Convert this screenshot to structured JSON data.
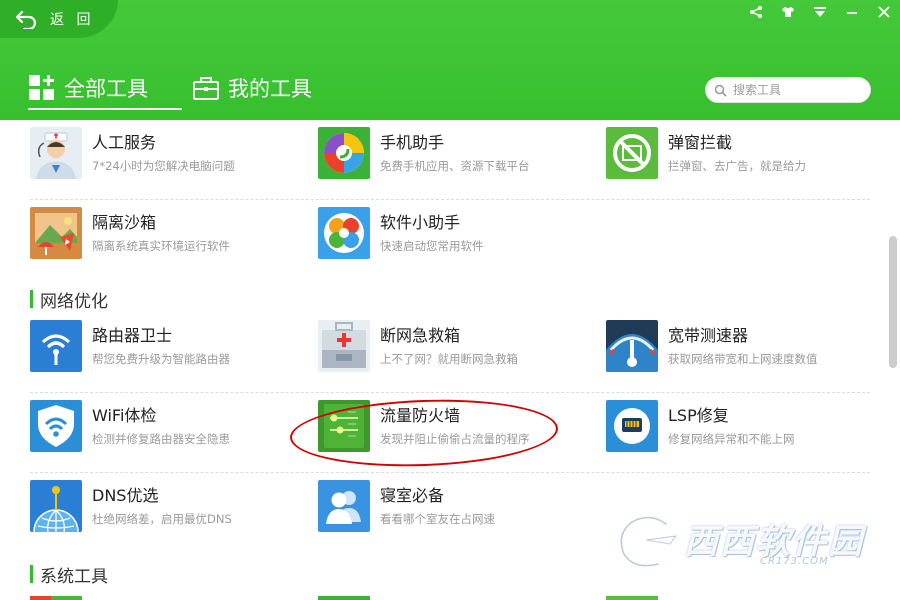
{
  "header": {
    "back_label": "返 回",
    "tabs": {
      "all": "全部工具",
      "mine": "我的工具"
    },
    "search_placeholder": "搜索工具"
  },
  "tools_top": [
    {
      "name": "人工服务",
      "desc": "7*24小时为您解决电脑问题",
      "icon": "customer-service-icon"
    },
    {
      "name": "手机助手",
      "desc": "免费手机应用、资源下载平台",
      "icon": "phone-assistant-icon"
    },
    {
      "name": "弹窗拦截",
      "desc": "拦弹窗、去广告，就是给力",
      "icon": "popup-blocker-icon"
    },
    {
      "name": "隔离沙箱",
      "desc": "隔离系统真实环境运行软件",
      "icon": "sandbox-icon"
    },
    {
      "name": "软件小助手",
      "desc": "快速启动您常用软件",
      "icon": "software-helper-icon"
    }
  ],
  "sections": {
    "network": "网络优化",
    "system": "系统工具"
  },
  "tools_network": [
    {
      "name": "路由器卫士",
      "desc": "帮您免费升级为智能路由器",
      "icon": "router-guard-icon"
    },
    {
      "name": "断网急救箱",
      "desc": "上不了网？就用断网急救箱",
      "icon": "first-aid-kit-icon"
    },
    {
      "name": "宽带测速器",
      "desc": "获取网络带宽和上网速度数值",
      "icon": "speedometer-icon"
    },
    {
      "name": "WiFi体检",
      "desc": "检测并修复路由器安全隐患",
      "icon": "wifi-check-icon"
    },
    {
      "name": "流量防火墙",
      "desc": "发现并阻止偷偷占流量的程序",
      "icon": "traffic-firewall-icon"
    },
    {
      "name": "LSP修复",
      "desc": "修复网络异常和不能上网",
      "icon": "lsp-repair-icon"
    },
    {
      "name": "DNS优选",
      "desc": "杜绝网络差，启用最优DNS",
      "icon": "dns-globe-icon"
    },
    {
      "name": "寝室必备",
      "desc": "看看哪个室友在占网速",
      "icon": "roommates-icon"
    }
  ],
  "watermark": {
    "title": "西西软件园",
    "sub": "CR173.COM"
  },
  "colors": {
    "header_green": "#3cc433",
    "accent_green": "#35b930",
    "annotation_red": "#d40000"
  }
}
